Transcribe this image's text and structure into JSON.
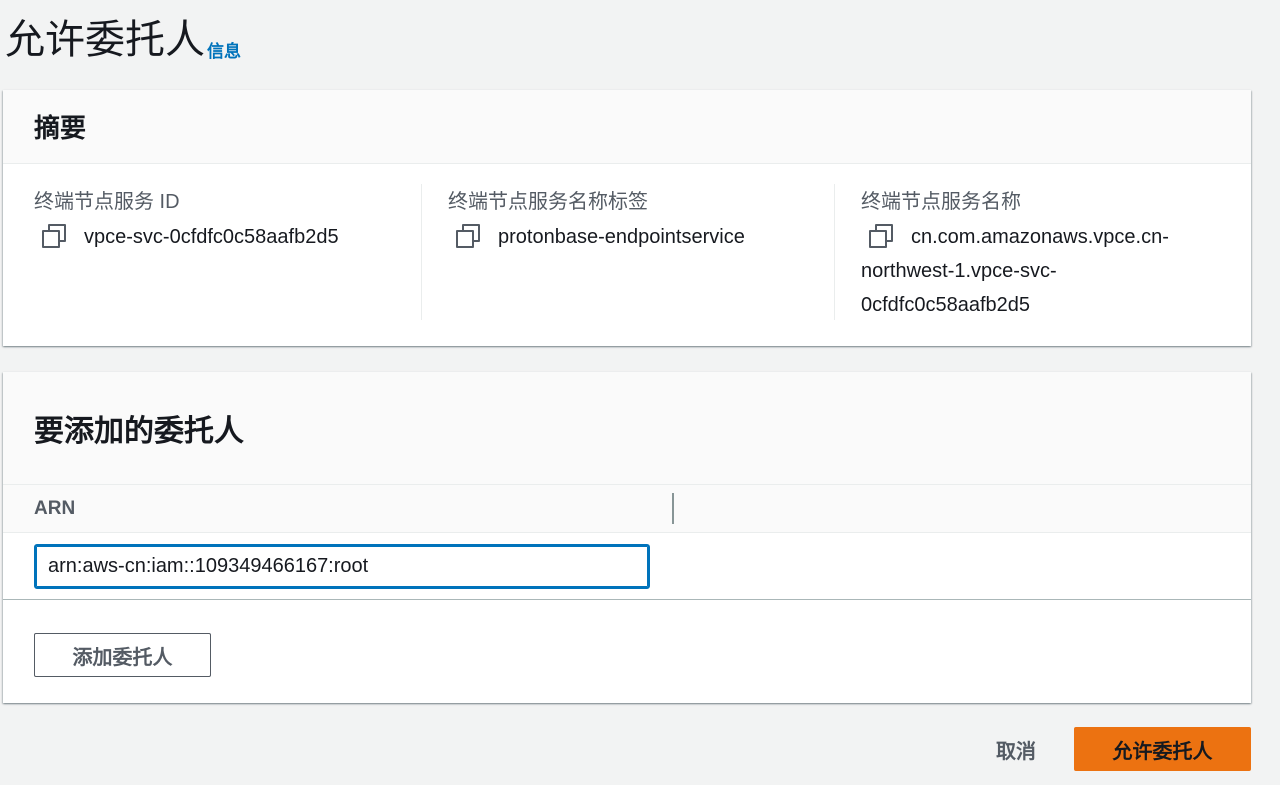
{
  "page": {
    "title": "允许委托人",
    "info_link": "信息"
  },
  "summary": {
    "title": "摘要",
    "fields": [
      {
        "label": "终端节点服务 ID",
        "value": "vpce-svc-0cfdfc0c58aafb2d5"
      },
      {
        "label": "终端节点服务名称标签",
        "value": "protonbase-endpointservice"
      },
      {
        "label": "终端节点服务名称",
        "value": "cn.com.amazonaws.vpce.cn-northwest-1.vpce-svc-0cfdfc0c58aafb2d5"
      }
    ]
  },
  "principals": {
    "title": "要添加的委托人",
    "column_header": "ARN",
    "arn_value": "arn:aws-cn:iam::109349466167:root",
    "add_button": "添加委托人"
  },
  "footer": {
    "cancel": "取消",
    "submit": "允许委托人"
  },
  "colors": {
    "primary_button": "#ec7211",
    "link": "#0073bb",
    "input_focus": "#0073bb"
  }
}
